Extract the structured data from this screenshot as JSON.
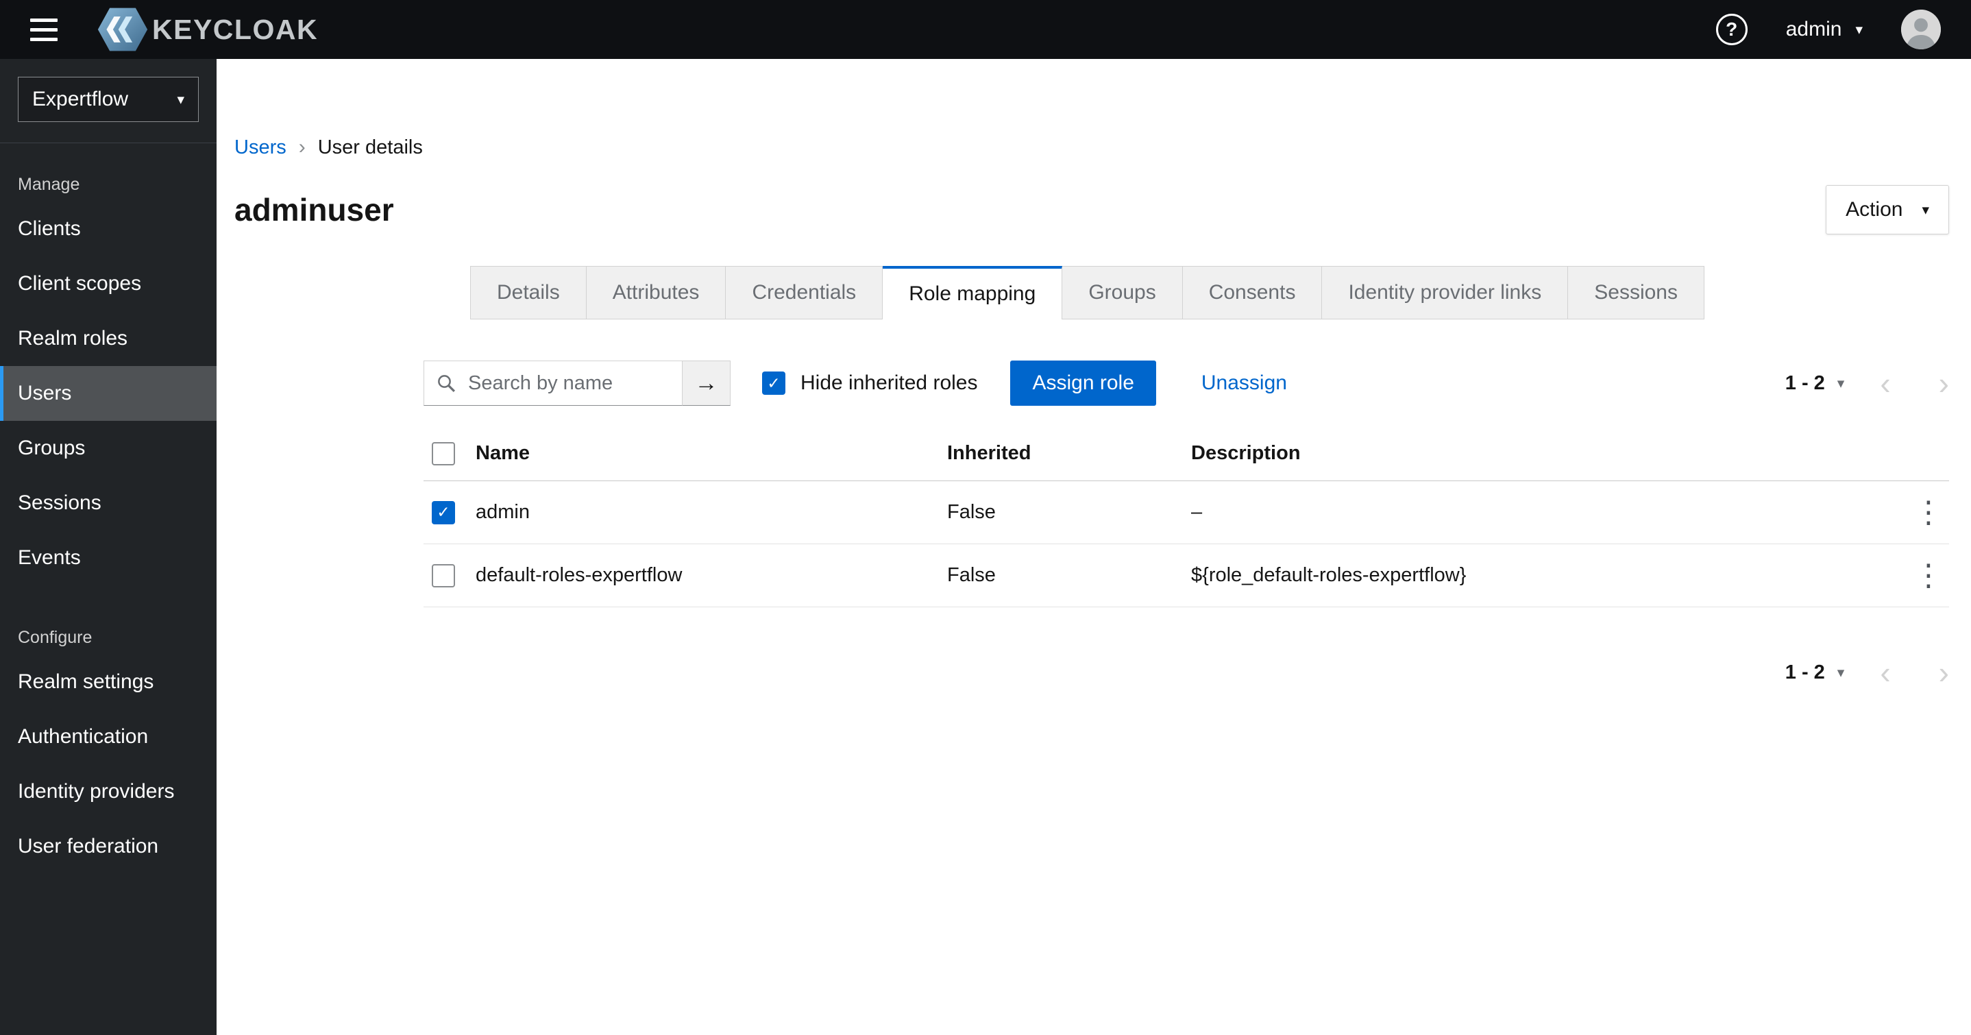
{
  "header": {
    "brand": "KEYCLOAK",
    "username": "admin"
  },
  "sidebar": {
    "realm": "Expertflow",
    "sections": [
      {
        "label": "Manage",
        "items": [
          {
            "label": "Clients"
          },
          {
            "label": "Client scopes"
          },
          {
            "label": "Realm roles"
          },
          {
            "label": "Users",
            "selected": true
          },
          {
            "label": "Groups"
          },
          {
            "label": "Sessions"
          },
          {
            "label": "Events"
          }
        ]
      },
      {
        "label": "Configure",
        "items": [
          {
            "label": "Realm settings"
          },
          {
            "label": "Authentication"
          },
          {
            "label": "Identity providers"
          },
          {
            "label": "User federation"
          }
        ]
      }
    ]
  },
  "breadcrumb": {
    "link": "Users",
    "current": "User details"
  },
  "page": {
    "title": "adminuser",
    "action_label": "Action"
  },
  "tabs": {
    "active": "Role mapping",
    "items": [
      "Details",
      "Attributes",
      "Credentials",
      "Role mapping",
      "Groups",
      "Consents",
      "Identity provider links",
      "Sessions"
    ]
  },
  "toolbar": {
    "search_placeholder": "Search by name",
    "hide_inherited_label": "Hide inherited roles",
    "hide_inherited_checked": true,
    "assign_label": "Assign role",
    "unassign_label": "Unassign"
  },
  "pagination": {
    "range": "1 - 2"
  },
  "table": {
    "columns": [
      "Name",
      "Inherited",
      "Description"
    ],
    "rows": [
      {
        "checked": true,
        "name": "admin",
        "inherited": "False",
        "description": "–"
      },
      {
        "checked": false,
        "name": "default-roles-expertflow",
        "inherited": "False",
        "description": "${role_default-roles-expertflow}"
      }
    ]
  },
  "icons": {
    "question": "?",
    "caret_down": "▾",
    "breadcrumb_sep": "›",
    "arrow_right": "→",
    "check": "✓",
    "kebab": "⋮",
    "chevron_left": "‹",
    "chevron_right": "›"
  },
  "colors": {
    "accent": "#0066cc",
    "header_bg": "#0e1013",
    "sidebar_bg": "#212427",
    "nav_selected_bg": "#4f5255",
    "nav_accent": "#2b9af3",
    "tab_inactive_bg": "#f0f0f0"
  }
}
